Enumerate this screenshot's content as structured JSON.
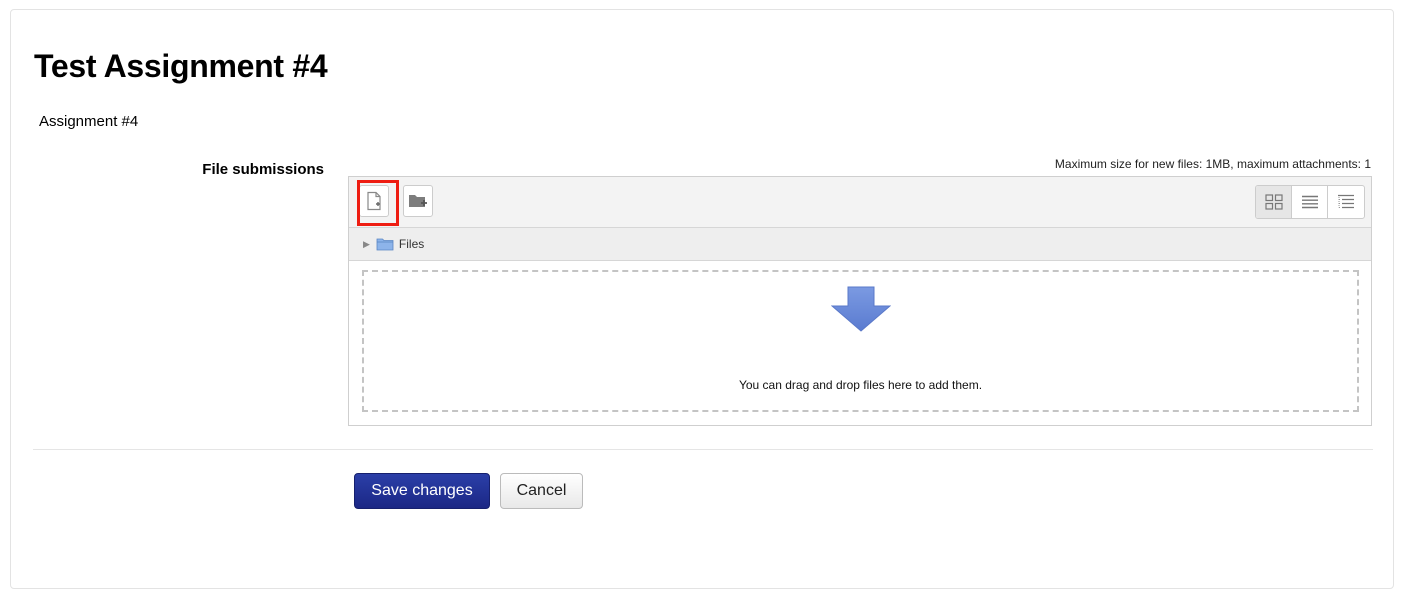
{
  "page": {
    "title": "Test Assignment #4",
    "intro": "Assignment #4"
  },
  "form": {
    "field_label": "File submissions",
    "max_info": "Maximum size for new files: 1MB, maximum attachments: 1"
  },
  "filepicker": {
    "toolbar": {
      "add_file_icon": "add-file-icon",
      "add_folder_icon": "add-folder-icon",
      "views": [
        "icons-view",
        "list-view",
        "tree-view"
      ],
      "active_view": "icons-view"
    },
    "path": {
      "folder_label": "Files"
    },
    "dropzone": {
      "message": "You can drag and drop files here to add them."
    }
  },
  "actions": {
    "save_label": "Save changes",
    "cancel_label": "Cancel"
  },
  "colors": {
    "primary": "#1f2c8f",
    "highlight": "#ee1d12",
    "drop_arrow": "#6f8fdc"
  }
}
